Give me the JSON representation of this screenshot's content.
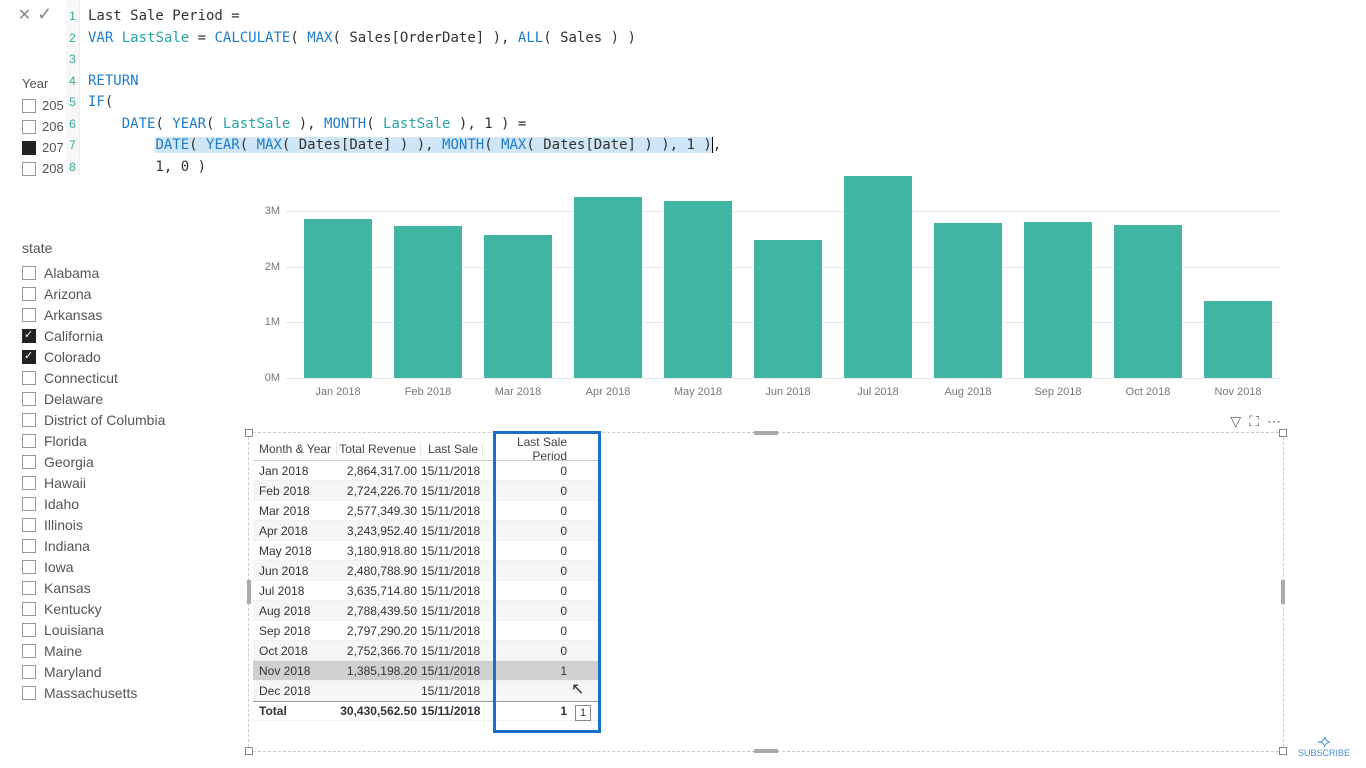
{
  "formula": {
    "lines": [
      "Last Sale Period =",
      "VAR LastSale = CALCULATE( MAX( Sales[OrderDate] ), ALL( Sales ) )",
      "",
      "RETURN",
      "IF(",
      "    DATE( YEAR( LastSale ), MONTH( LastSale ), 1 ) =",
      "        DATE( YEAR( MAX( Dates[Date] ) ), MONTH( MAX( Dates[Date] ) ), 1 ),",
      "        1, 0 )"
    ]
  },
  "year_slicer": {
    "title": "Year",
    "items": [
      {
        "label": "205",
        "checked": false
      },
      {
        "label": "206",
        "checked": false
      },
      {
        "label": "207",
        "checked": true
      },
      {
        "label": "208",
        "checked": false
      }
    ]
  },
  "state_slicer": {
    "title": "state",
    "items": [
      {
        "label": "Alabama",
        "checked": false
      },
      {
        "label": "Arizona",
        "checked": false
      },
      {
        "label": "Arkansas",
        "checked": false
      },
      {
        "label": "California",
        "checked": true
      },
      {
        "label": "Colorado",
        "checked": true
      },
      {
        "label": "Connecticut",
        "checked": false
      },
      {
        "label": "Delaware",
        "checked": false
      },
      {
        "label": "District of Columbia",
        "checked": false
      },
      {
        "label": "Florida",
        "checked": false
      },
      {
        "label": "Georgia",
        "checked": false
      },
      {
        "label": "Hawaii",
        "checked": false
      },
      {
        "label": "Idaho",
        "checked": false
      },
      {
        "label": "Illinois",
        "checked": false
      },
      {
        "label": "Indiana",
        "checked": false
      },
      {
        "label": "Iowa",
        "checked": false
      },
      {
        "label": "Kansas",
        "checked": false
      },
      {
        "label": "Kentucky",
        "checked": false
      },
      {
        "label": "Louisiana",
        "checked": false
      },
      {
        "label": "Maine",
        "checked": false
      },
      {
        "label": "Maryland",
        "checked": false
      },
      {
        "label": "Massachusetts",
        "checked": false
      }
    ]
  },
  "chart_data": {
    "type": "bar",
    "categories": [
      "Jan 2018",
      "Feb 2018",
      "Mar 2018",
      "Apr 2018",
      "May 2018",
      "Jun 2018",
      "Jul 2018",
      "Aug 2018",
      "Sep 2018",
      "Oct 2018",
      "Nov 2018"
    ],
    "values": [
      2864317,
      2724227,
      2577349,
      3243952,
      3180919,
      2480789,
      3635715,
      2788440,
      2797290,
      2752367,
      1385198
    ],
    "y_ticks": [
      0,
      1000000,
      2000000,
      3000000
    ],
    "y_tick_labels": [
      "0M",
      "1M",
      "2M",
      "3M"
    ],
    "ylim": [
      0,
      3700000
    ],
    "color": "#40b5a4"
  },
  "table": {
    "columns": [
      "Month & Year",
      "Total Revenue",
      "Last Sale",
      "Last Sale Period"
    ],
    "rows": [
      {
        "month": "Jan 2018",
        "rev": "2,864,317.00",
        "last": "15/11/2018",
        "period": "0"
      },
      {
        "month": "Feb 2018",
        "rev": "2,724,226.70",
        "last": "15/11/2018",
        "period": "0"
      },
      {
        "month": "Mar 2018",
        "rev": "2,577,349.30",
        "last": "15/11/2018",
        "period": "0"
      },
      {
        "month": "Apr 2018",
        "rev": "3,243,952.40",
        "last": "15/11/2018",
        "period": "0"
      },
      {
        "month": "May 2018",
        "rev": "3,180,918.80",
        "last": "15/11/2018",
        "period": "0"
      },
      {
        "month": "Jun 2018",
        "rev": "2,480,788.90",
        "last": "15/11/2018",
        "period": "0"
      },
      {
        "month": "Jul 2018",
        "rev": "3,635,714.80",
        "last": "15/11/2018",
        "period": "0"
      },
      {
        "month": "Aug 2018",
        "rev": "2,788,439.50",
        "last": "15/11/2018",
        "period": "0"
      },
      {
        "month": "Sep 2018",
        "rev": "2,797,290.20",
        "last": "15/11/2018",
        "period": "0"
      },
      {
        "month": "Oct 2018",
        "rev": "2,752,366.70",
        "last": "15/11/2018",
        "period": "0"
      },
      {
        "month": "Nov 2018",
        "rev": "1,385,198.20",
        "last": "15/11/2018",
        "period": "1"
      },
      {
        "month": "Dec 2018",
        "rev": "",
        "last": "15/11/2018",
        "period": ""
      }
    ],
    "total": {
      "month": "Total",
      "rev": "30,430,562.50",
      "last": "15/11/2018",
      "period": "1"
    },
    "tooltip": "1"
  },
  "logo": {
    "text": "SUBSCRIBE"
  }
}
